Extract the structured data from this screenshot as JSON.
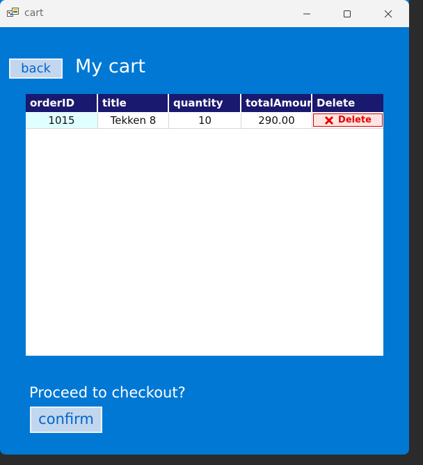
{
  "window": {
    "title": "cart"
  },
  "header": {
    "back_label": "back",
    "page_title": "My cart"
  },
  "table": {
    "columns": [
      "orderID",
      "title",
      "quantity",
      "totalAmour",
      "Delete"
    ],
    "rows": [
      {
        "orderID": "1015",
        "title": "Tekken 8",
        "quantity": "10",
        "totalAmount": "290.00",
        "delete_label": "Delete"
      }
    ]
  },
  "footer": {
    "prompt": "Proceed to checkout?",
    "confirm_label": "confirm"
  },
  "colors": {
    "window_bg": "#0078d4",
    "header_bg": "#191970",
    "first_col_bg": "#e0ffff",
    "delete_text": "#e60000"
  }
}
